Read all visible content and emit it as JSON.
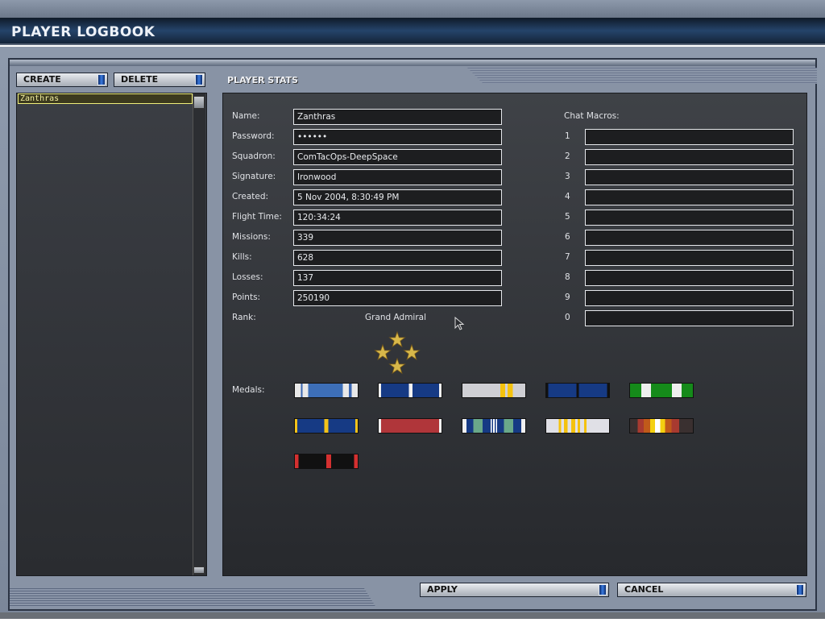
{
  "window": {
    "title": "PLAYER LOGBOOK"
  },
  "left": {
    "create_label": "CREATE",
    "delete_label": "DELETE",
    "players": [
      "Zanthras"
    ]
  },
  "stats": {
    "title": "PLAYER STATS",
    "fields": [
      {
        "label": "Name:",
        "value": "Zanthras"
      },
      {
        "label": "Password:",
        "value": "••••••"
      },
      {
        "label": "Squadron:",
        "value": "ComTacOps-DeepSpace"
      },
      {
        "label": "Signature:",
        "value": "Ironwood"
      },
      {
        "label": "Created:",
        "value": "5 Nov 2004,  8:30:49 PM"
      },
      {
        "label": "Flight Time:",
        "value": "120:34:24"
      },
      {
        "label": "Missions:",
        "value": "339"
      },
      {
        "label": "Kills:",
        "value": "628"
      },
      {
        "label": "Losses:",
        "value": "137"
      },
      {
        "label": "Points:",
        "value": "250190"
      }
    ],
    "rank_label": "Rank:",
    "rank_value": "Grand Admiral",
    "rank_insignia": "four-gold-stars",
    "medals_label": "Medals:",
    "medals": [
      [
        [
          "#e8e8e8",
          8
        ],
        [
          "#3a66b0",
          2
        ],
        [
          "#e8e8e8",
          8
        ],
        [
          "#3d6fb8",
          46
        ],
        [
          "#e8e8e8",
          8
        ],
        [
          "#3a66b0",
          4
        ],
        [
          "#e8e8e8",
          8
        ]
      ],
      [
        [
          "#f0f0f0",
          4
        ],
        [
          "#163a84",
          44
        ],
        [
          "#f2f2f2",
          6
        ],
        [
          "#163a84",
          42
        ],
        [
          "#f0f0f0",
          4
        ]
      ],
      [
        [
          "#cfcfd4",
          60
        ],
        [
          "#f4c20e",
          8
        ],
        [
          "#cfcfd4",
          4
        ],
        [
          "#f4c20e",
          8
        ],
        [
          "#cfcfd4",
          20
        ]
      ],
      [
        [
          "#111",
          3
        ],
        [
          "#163a84",
          45
        ],
        [
          "#111",
          4
        ],
        [
          "#163a84",
          45
        ],
        [
          "#111",
          3
        ]
      ],
      [
        [
          "#158a1a",
          16
        ],
        [
          "#eee",
          14
        ],
        [
          "#158a1a",
          30
        ],
        [
          "#eee",
          14
        ],
        [
          "#158a1a",
          16
        ]
      ],
      [
        [
          "#f2c21a",
          4
        ],
        [
          "#163a84",
          42
        ],
        [
          "#f2c21a",
          6
        ],
        [
          "#163a84",
          42
        ],
        [
          "#f2c21a",
          4
        ]
      ],
      [
        [
          "#f0f0f0",
          4
        ],
        [
          "#b0363a",
          92
        ],
        [
          "#f0f0f0",
          4
        ]
      ],
      [
        [
          "#f0f0f0",
          6
        ],
        [
          "#163a84",
          10
        ],
        [
          "#6aa88a",
          14
        ],
        [
          "#163a84",
          12
        ],
        [
          "#fff",
          2
        ],
        [
          "#163a84",
          2
        ],
        [
          "#fff",
          2
        ],
        [
          "#163a84",
          2
        ],
        [
          "#fff",
          2
        ],
        [
          "#163a84",
          10
        ],
        [
          "#6aa88a",
          14
        ],
        [
          "#163a84",
          12
        ],
        [
          "#f0f0f0",
          6
        ]
      ],
      [
        [
          "#e0e0e6",
          20
        ],
        [
          "#f4c20e",
          4
        ],
        [
          "#e0e0e6",
          4
        ],
        [
          "#f4c20e",
          6
        ],
        [
          "#e0e0e6",
          6
        ],
        [
          "#f4c20e",
          6
        ],
        [
          "#e0e0e6",
          4
        ],
        [
          "#f4c20e",
          4
        ],
        [
          "#e0e0e6",
          6
        ],
        [
          "#f4c20e",
          4
        ],
        [
          "#e0e0e6",
          36
        ]
      ],
      [
        [
          "#3a3030",
          12
        ],
        [
          "#a83a30",
          10
        ],
        [
          "#c05a1a",
          10
        ],
        [
          "#f4d010",
          8
        ],
        [
          "#fff",
          8
        ],
        [
          "#f4d010",
          8
        ],
        [
          "#c05a1a",
          10
        ],
        [
          "#a83a30",
          12
        ],
        [
          "#3a3030",
          22
        ]
      ],
      [
        [
          "#d43030",
          6
        ],
        [
          "#111",
          44
        ],
        [
          "#d43030",
          8
        ],
        [
          "#111",
          36
        ],
        [
          "#d43030",
          6
        ]
      ]
    ]
  },
  "chat": {
    "title": "Chat Macros:",
    "slots": [
      {
        "key": "1",
        "value": ""
      },
      {
        "key": "2",
        "value": ""
      },
      {
        "key": "3",
        "value": ""
      },
      {
        "key": "4",
        "value": ""
      },
      {
        "key": "5",
        "value": ""
      },
      {
        "key": "6",
        "value": ""
      },
      {
        "key": "7",
        "value": ""
      },
      {
        "key": "8",
        "value": ""
      },
      {
        "key": "9",
        "value": ""
      },
      {
        "key": "0",
        "value": ""
      }
    ]
  },
  "footer": {
    "apply_label": "APPLY",
    "cancel_label": "CANCEL"
  },
  "colors": {
    "accent": "#3b7be0",
    "selection": "#f0f07a",
    "rank_gold": "#d8b84a"
  }
}
